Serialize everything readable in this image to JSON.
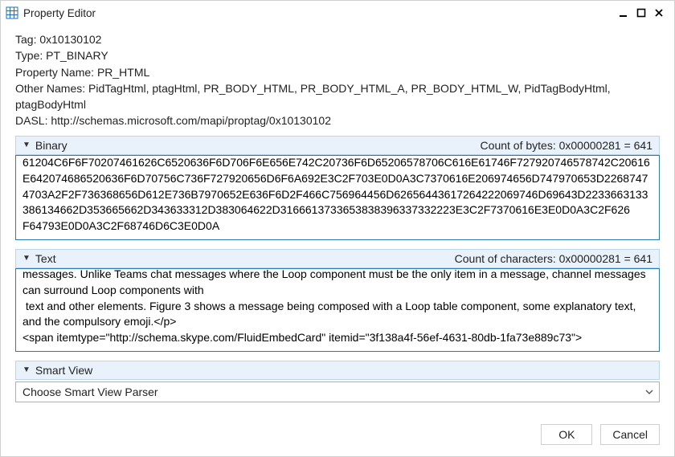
{
  "window": {
    "title": "Property Editor",
    "icons": {
      "app": "grid-icon",
      "minimize": "minimize-icon",
      "maximize": "maximize-icon",
      "close": "close-icon"
    }
  },
  "meta": {
    "tag_label": "Tag:",
    "tag_value": "0x10130102",
    "type_label": "Type:",
    "type_value": "PT_BINARY",
    "propname_label": "Property Name:",
    "propname_value": "PR_HTML",
    "othernames_label": "Other Names:",
    "othernames_value": "PidTagHtml, ptagHtml, PR_BODY_HTML, PR_BODY_HTML_A, PR_BODY_HTML_W, PidTagBodyHtml, ptagBodyHtml",
    "dasl_label": "DASL:",
    "dasl_value": "http://schemas.microsoft.com/mapi/proptag/0x10130102"
  },
  "sections": {
    "binary": {
      "title": "Binary",
      "count_label": "Count of bytes: 0x00000281 = 641",
      "value": "61204C6F6F70207461626C6520636F6D706F6E656E742C20736F6D65206578706C616E61746F727920746578742C20616E642074686520636F6D70756C736F727920656D6F6A692E3C2F703E0D0A3C7370616E206974656D747970653D2268747\n4703A2F2F736368656D612E736B7970652E636F6D2F466C756964456D62656443617264222069746D69643D2233663133386134662D353665662D343633312D383064622D3166613733653838396337332223E3C2F7370616E3E0D0A3C2F626\nF64793E0D0A3C2F68746D6C3E0D0A"
    },
    "text": {
      "title": "Text",
      "count_label": "Count of characters: 0x00000281 = 641",
      "value": "messages. Unlike Teams chat messages where the Loop component must be the only item in a message, channel messages can surround Loop components with\n text and other elements. Figure 3 shows a message being composed with a Loop table component, some explanatory text, and the compulsory emoji.</p>\n<span itemtype=\"http://schema.skype.com/FluidEmbedCard\" itemid=\"3f138a4f-56ef-4631-80db-1fa73e889c73\">"
    },
    "smartview": {
      "title": "Smart View",
      "selected": "Choose Smart View Parser"
    }
  },
  "footer": {
    "ok": "OK",
    "cancel": "Cancel"
  }
}
